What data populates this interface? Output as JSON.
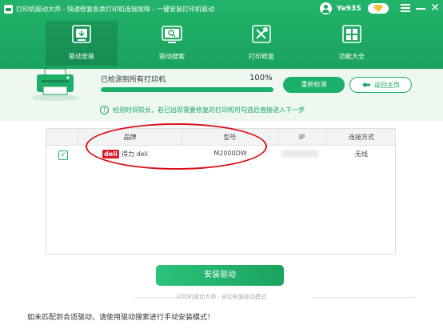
{
  "titlebar": {
    "title": "打印机驱动大师 - 快速修复各类打印机连接故障 - 一键安装打印机驱动",
    "username": "Ye93S"
  },
  "nav": {
    "items": [
      {
        "label": "驱动安装",
        "icon": "printer-download-icon",
        "active": true
      },
      {
        "label": "驱动搜索",
        "icon": "search-monitor-icon",
        "active": false
      },
      {
        "label": "打印修复",
        "icon": "repair-tools-icon",
        "active": false
      },
      {
        "label": "功能大全",
        "icon": "apps-grid-icon",
        "active": false
      }
    ]
  },
  "progress": {
    "status": "已检测到所有打印机",
    "percent_text": "100%",
    "percent": 1.0,
    "redetect_label": "重新检测",
    "return_label": "返回主页",
    "tip": "检测时间较长，若已出现需要修复的打印机可勾选后直接进入下一步"
  },
  "table": {
    "headers": [
      "品牌",
      "型号",
      "IP",
      "连接方式"
    ],
    "rows": [
      {
        "checked": true,
        "brand_logo": "deli",
        "brand": "得力 deli",
        "model": "M2000DW",
        "connection": "无线"
      }
    ]
  },
  "install": {
    "button_label": "安装驱动",
    "footer": "打印机驱动大师 · 自动安装驱动模式"
  },
  "note": "如未匹配到合适驱动，请使用驱动搜索进行手动安装模式！",
  "colors": {
    "accent": "#1aa35e",
    "annotation": "#d8111b",
    "brand_red": "#d61f26"
  }
}
